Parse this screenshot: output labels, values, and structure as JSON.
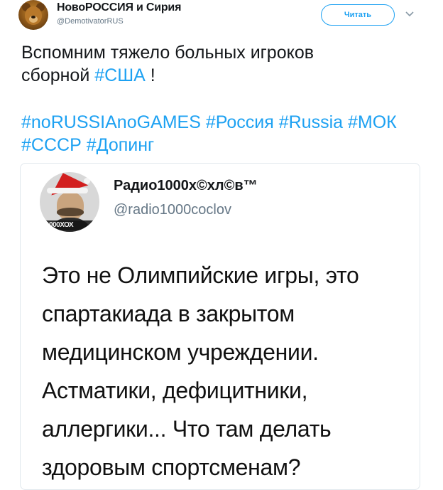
{
  "account": {
    "name": "НовоРОССИЯ и Сирия",
    "handle": "@DemotivatorRUS",
    "follow_label": "Читать"
  },
  "tweet": {
    "line1": "Вспомним тяжело больных игроков",
    "line2_prefix": "сборной ",
    "line2_tag": "#США",
    "line2_suffix": " !",
    "hashtags_line1": [
      "#noRUSSIAnoGAMES",
      "#Россия",
      "#Russia",
      "#МОК"
    ],
    "hashtags_line2": [
      "#СССР",
      "#Допинг"
    ]
  },
  "quoted": {
    "name": "Радио1000х©хл©в™",
    "handle": "@radio1000coclov",
    "avatar_logo": "1000ХОХ",
    "text_lines": [
      "Это не Олимпийские игры, это",
      "спартакиада в закрытом",
      "медицинском учреждении.",
      "Астматики, дефицитники,",
      "аллергики... Что там делать",
      "здоровым спортсменам?"
    ]
  },
  "icons": {
    "avatar": "fox-avatar-icon",
    "chevron": "chevron-down-icon",
    "quoted_avatar": "santa-hat-avatar-icon"
  },
  "colors": {
    "accent": "#1da1f2",
    "secondary_text": "#657786",
    "border": "#e1e8ed"
  }
}
